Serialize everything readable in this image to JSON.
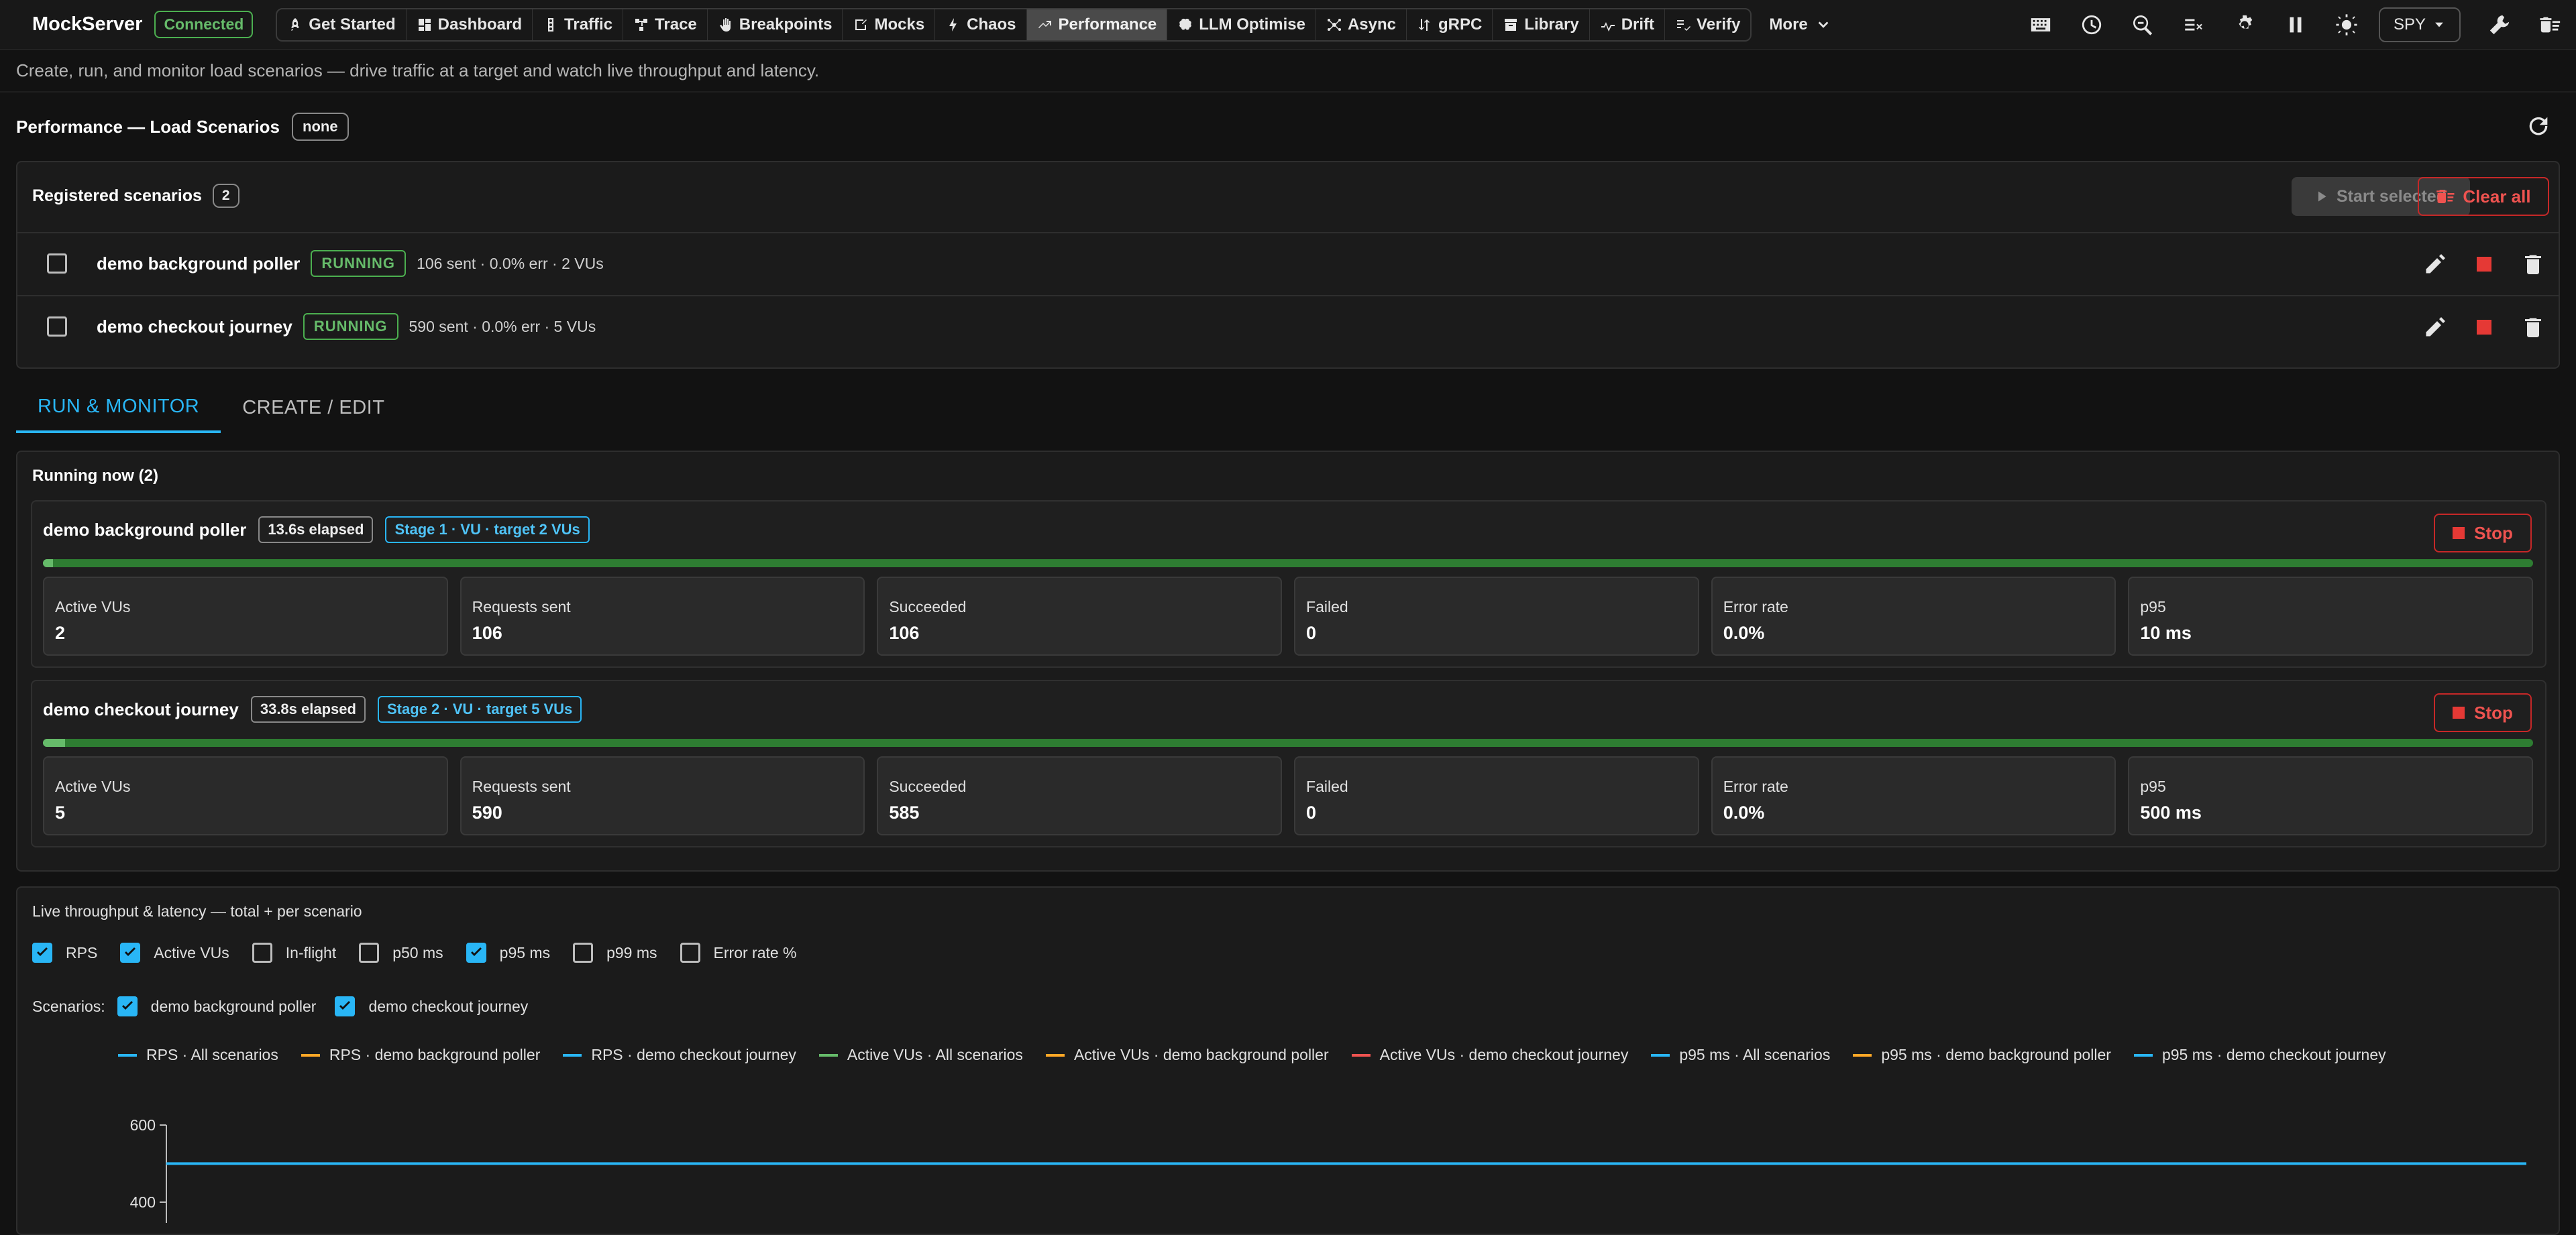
{
  "app": {
    "title": "MockServer",
    "status": "Connected"
  },
  "nav": {
    "items": [
      {
        "label": "Get Started",
        "icon": "rocket-icon"
      },
      {
        "label": "Dashboard",
        "icon": "dashboard-icon"
      },
      {
        "label": "Traffic",
        "icon": "traffic-light-icon"
      },
      {
        "label": "Trace",
        "icon": "trace-icon"
      },
      {
        "label": "Breakpoints",
        "icon": "hand-icon"
      },
      {
        "label": "Mocks",
        "icon": "mocks-icon"
      },
      {
        "label": "Chaos",
        "icon": "bolt-icon"
      },
      {
        "label": "Performance",
        "icon": "trending-up-icon",
        "active": true
      },
      {
        "label": "LLM Optimise",
        "icon": "brain-icon"
      },
      {
        "label": "Async",
        "icon": "hub-icon"
      },
      {
        "label": "gRPC",
        "icon": "grpc-icon"
      },
      {
        "label": "Library",
        "icon": "archive-icon"
      },
      {
        "label": "Drift",
        "icon": "drift-icon"
      },
      {
        "label": "Verify",
        "icon": "checklist-icon"
      }
    ],
    "more": "More"
  },
  "toolbar": {
    "mode": "SPY"
  },
  "page": {
    "subtitle": "Create, run, and monitor load scenarios — drive traffic at a target and watch live throughput and latency.",
    "title": "Performance — Load Scenarios",
    "badge": "none"
  },
  "registered": {
    "title": "Registered scenarios",
    "count": "2",
    "start_label": "Start selected",
    "clear_label": "Clear all",
    "rows": [
      {
        "name": "demo background poller",
        "status": "RUNNING",
        "stats": "106 sent · 0.0% err · 2 VUs"
      },
      {
        "name": "demo checkout journey",
        "status": "RUNNING",
        "stats": "590 sent · 0.0% err · 5 VUs"
      }
    ]
  },
  "tabs": [
    "RUN & MONITOR",
    "CREATE / EDIT"
  ],
  "running": {
    "title": "Running now (2)",
    "stop_label": "Stop",
    "jobs": [
      {
        "name": "demo background poller",
        "elapsed": "13.6s elapsed",
        "stage": "Stage 1 · VU · target 2 VUs",
        "progress": 0.004,
        "metrics": [
          {
            "label": "Active VUs",
            "value": "2"
          },
          {
            "label": "Requests sent",
            "value": "106"
          },
          {
            "label": "Succeeded",
            "value": "106"
          },
          {
            "label": "Failed",
            "value": "0"
          },
          {
            "label": "Error rate",
            "value": "0.0%"
          },
          {
            "label": "p95",
            "value": "10 ms"
          }
        ]
      },
      {
        "name": "demo checkout journey",
        "elapsed": "33.8s elapsed",
        "stage": "Stage 2 · VU · target 5 VUs",
        "progress": 0.009,
        "metrics": [
          {
            "label": "Active VUs",
            "value": "5"
          },
          {
            "label": "Requests sent",
            "value": "590"
          },
          {
            "label": "Succeeded",
            "value": "585"
          },
          {
            "label": "Failed",
            "value": "0"
          },
          {
            "label": "Error rate",
            "value": "0.0%"
          },
          {
            "label": "p95",
            "value": "500 ms"
          }
        ]
      }
    ]
  },
  "live": {
    "title": "Live throughput & latency — total + per scenario",
    "toggles": [
      {
        "label": "RPS",
        "checked": true
      },
      {
        "label": "Active VUs",
        "checked": true
      },
      {
        "label": "In-flight",
        "checked": false
      },
      {
        "label": "p50 ms",
        "checked": false
      },
      {
        "label": "p95 ms",
        "checked": true
      },
      {
        "label": "p99 ms",
        "checked": false
      },
      {
        "label": "Error rate %",
        "checked": false
      }
    ],
    "scenarios_label": "Scenarios:",
    "scenarios": [
      {
        "label": "demo background poller",
        "checked": true
      },
      {
        "label": "demo checkout journey",
        "checked": true
      }
    ]
  },
  "chart_data": {
    "type": "line",
    "title": "",
    "xlabel": "",
    "ylabel": "",
    "ylim": [
      200,
      600
    ],
    "yticks": [
      600,
      400
    ],
    "legend_position": "top",
    "series": [
      {
        "name": "RPS · All scenarios",
        "color": "#29b6f6",
        "values": []
      },
      {
        "name": "RPS · demo background poller",
        "color": "#ffa726",
        "values": []
      },
      {
        "name": "RPS · demo checkout journey",
        "color": "#29b6f6",
        "values": []
      },
      {
        "name": "Active VUs · All scenarios",
        "color": "#66bb6a",
        "values": []
      },
      {
        "name": "Active VUs · demo background poller",
        "color": "#ffa726",
        "values": []
      },
      {
        "name": "Active VUs · demo checkout journey",
        "color": "#ef5350",
        "values": []
      },
      {
        "name": "p95 ms · All scenarios",
        "color": "#29b6f6",
        "values": [
          500,
          500
        ]
      },
      {
        "name": "p95 ms · demo background poller",
        "color": "#ffa726",
        "values": []
      },
      {
        "name": "p95 ms · demo checkout journey",
        "color": "#29b6f6",
        "values": [
          500,
          500
        ]
      }
    ]
  }
}
